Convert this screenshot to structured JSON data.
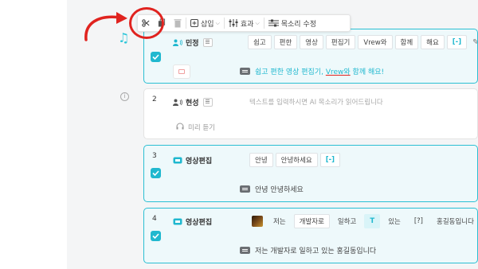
{
  "toolbar": {
    "insert_label": "삽입",
    "effect_label": "효과",
    "voice_edit_label": "목소리 수정",
    "icons": [
      "scissors-icon",
      "copy-icon",
      "trash-icon",
      "insert-plus-icon",
      "effect-sliders-icon",
      "voice-edit-icon"
    ]
  },
  "annotation": {
    "highlight_color": "#e0231f"
  },
  "accent_color": "#20b8cf",
  "clips": [
    {
      "speaker": "민정",
      "words": [
        "쉽고",
        "편한",
        "영상",
        "편집기",
        "Vrew와",
        "함께",
        "해요",
        "[-]"
      ],
      "subtitle_parts": [
        "쉽고 편한 영상 편집기, ",
        "Vrew와",
        " 함께 해요!"
      ]
    },
    {
      "number": "2",
      "speaker": "현성",
      "placeholder": "텍스트를 입력하시면 AI 목소리가 읽어드립니다",
      "preview_label": "미리 듣기"
    },
    {
      "number": "3",
      "speaker": "영상편집",
      "words": [
        "안녕",
        "안녕하세요",
        "[-]"
      ],
      "subtitle": "안녕 안녕하세요"
    },
    {
      "number": "4",
      "speaker": "영상편집",
      "words": [
        "저는",
        "개발자로",
        "일하고",
        "T",
        "있는",
        "[?]",
        "홍길동입니다"
      ],
      "subtitle": "저는 개발자로 일하고 있는 홍길동입니다"
    }
  ]
}
